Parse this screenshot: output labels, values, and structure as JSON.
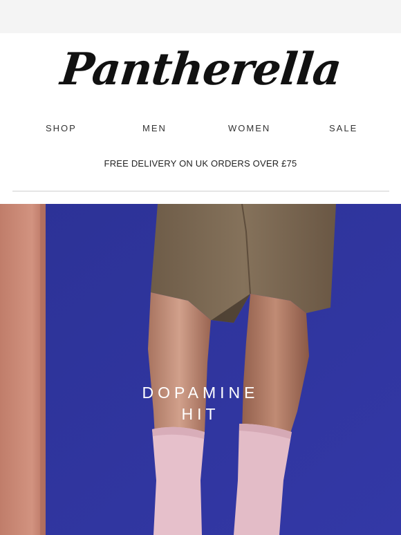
{
  "brand": {
    "logo_text": "Pantherella"
  },
  "nav": {
    "items": [
      {
        "label": "SHOP"
      },
      {
        "label": "MEN"
      },
      {
        "label": "WOMEN"
      },
      {
        "label": "SALE"
      }
    ]
  },
  "promo": {
    "text": "FREE DELIVERY ON UK ORDERS OVER £75"
  },
  "hero": {
    "heading_line1": "DOPAMINE",
    "heading_line2": "HIT"
  },
  "colors": {
    "wall_blue": "#2f34a0",
    "wall_pink": "#c98672",
    "shorts": "#7b6953",
    "skin": "#c28d74",
    "socks": "#e8c3cd"
  }
}
